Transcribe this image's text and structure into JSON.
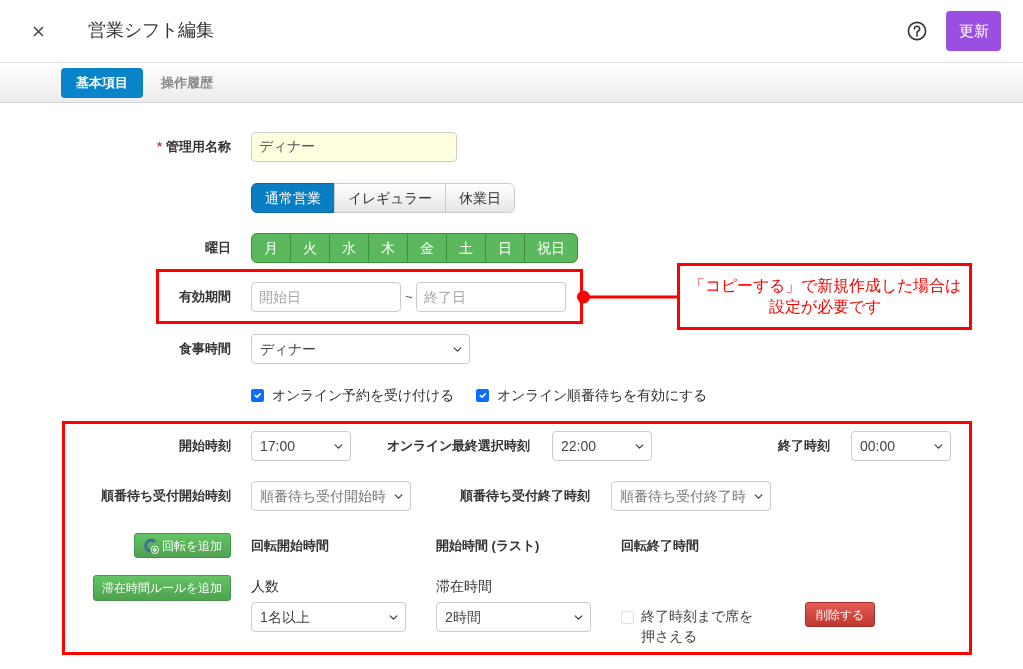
{
  "header": {
    "title": "営業シフト編集",
    "update_button": "更新"
  },
  "tabs": [
    {
      "label": "基本項目",
      "selected": true
    },
    {
      "label": "操作履歴",
      "selected": false
    }
  ],
  "name_field": {
    "required_mark": "*",
    "label": "管理用名称",
    "value": "ディナー"
  },
  "business_types": [
    {
      "label": "通常営業",
      "selected": true
    },
    {
      "label": "イレギュラー",
      "selected": false
    },
    {
      "label": "休業日",
      "selected": false
    }
  ],
  "weekdays": {
    "label": "曜日",
    "days": [
      {
        "label": "月",
        "selected": true
      },
      {
        "label": "火",
        "selected": true
      },
      {
        "label": "水",
        "selected": true
      },
      {
        "label": "木",
        "selected": true
      },
      {
        "label": "金",
        "selected": true
      },
      {
        "label": "土",
        "selected": true
      },
      {
        "label": "日",
        "selected": true
      },
      {
        "label": "祝日",
        "selected": true
      }
    ]
  },
  "valid_period": {
    "label": "有効期間",
    "start": {
      "placeholder": "開始日"
    },
    "separator": "~",
    "end": {
      "placeholder": "終了日"
    },
    "highlighted": true,
    "callout": "「コピーする」で新規作成した場合は設定が必要です"
  },
  "meal_time": {
    "label": "食事時間",
    "value": "ディナー"
  },
  "online_options": [
    {
      "label": "オンライン予約を受け付ける",
      "checked": true
    },
    {
      "label": "オンライン順番待ちを有効にする",
      "checked": true
    }
  ],
  "time_settings": {
    "highlighted": true,
    "times": [
      {
        "label": "開始時刻",
        "value": "17:00"
      },
      {
        "label": "オンライン最終選択時刻",
        "value": "22:00"
      },
      {
        "label": "終了時刻",
        "value": "00:00"
      }
    ],
    "waitlist": [
      {
        "label": "順番待ち受付開始時刻",
        "placeholder": "順番待ち受付開始時"
      },
      {
        "label": "順番待ち受付終了時刻",
        "placeholder": "順番待ち受付終了時"
      }
    ],
    "rotation": {
      "add_button": "回転を追加",
      "columns": [
        "回転開始時間",
        "開始時間 (ラスト)",
        "回転終了時間"
      ]
    },
    "stay_rule": {
      "add_button": "滞在時間ルールを追加",
      "fields": [
        {
          "label": "人数",
          "value": "1名以上"
        },
        {
          "label": "滞在時間",
          "value": "2時間"
        }
      ],
      "hold_seat": {
        "label": "終了時刻まで席を押さえる",
        "checked": false
      },
      "delete_button": "削除する"
    }
  }
}
